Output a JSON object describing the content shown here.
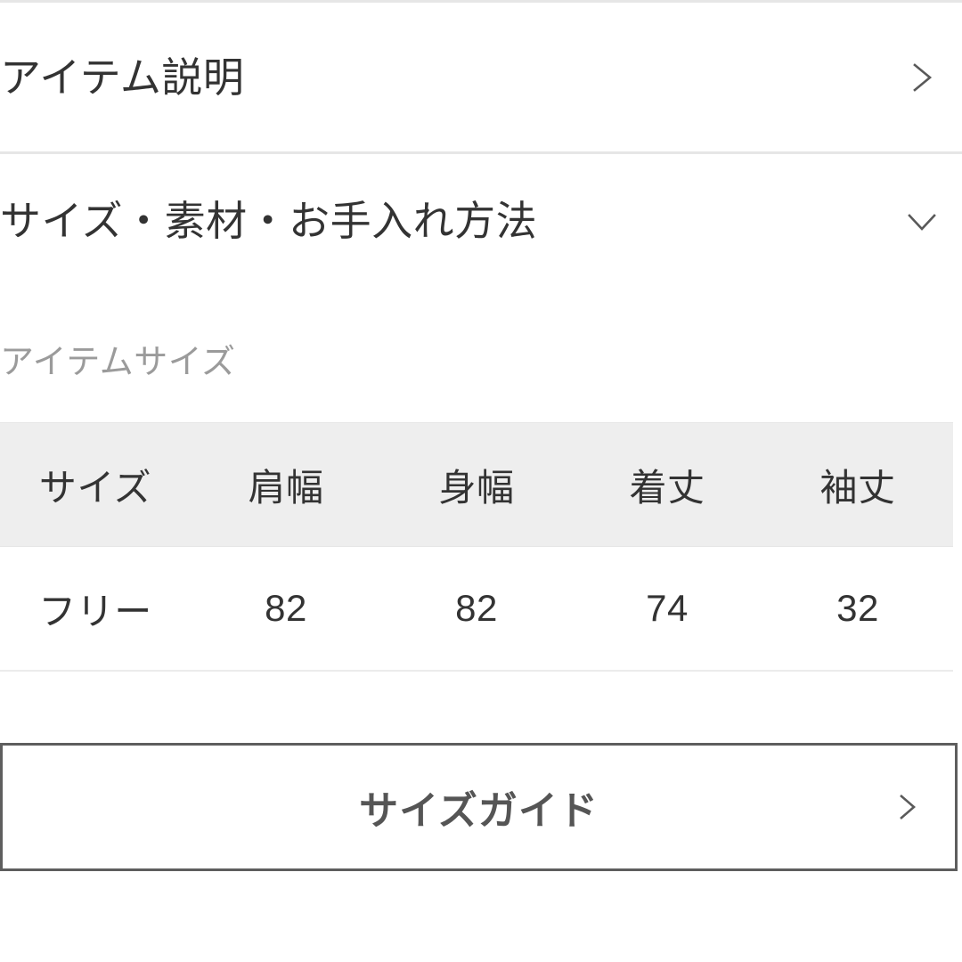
{
  "colors": {
    "text": "#333333",
    "muted": "#9b9b9b",
    "divider": "#e6e6e6",
    "table_header_bg": "#eeeeee",
    "table_row_border": "#ececec",
    "button_border": "#5e5e5e",
    "button_text": "#555555",
    "page_bg": "#ffffff"
  },
  "accordions": [
    {
      "label": "アイテム説明",
      "state": "collapsed",
      "icon": "chevron-right-icon"
    },
    {
      "label": "サイズ・素材・お手入れ方法",
      "state": "expanded",
      "icon": "chevron-down-icon"
    }
  ],
  "size_section": {
    "label": "アイテムサイズ",
    "table": {
      "headers": [
        "サイズ",
        "肩幅",
        "身幅",
        "着丈",
        "袖丈"
      ],
      "rows": [
        [
          "フリー",
          "82",
          "82",
          "74",
          "32"
        ]
      ]
    }
  },
  "size_guide_button": {
    "label": "サイズガイド",
    "icon": "chevron-right-icon"
  }
}
